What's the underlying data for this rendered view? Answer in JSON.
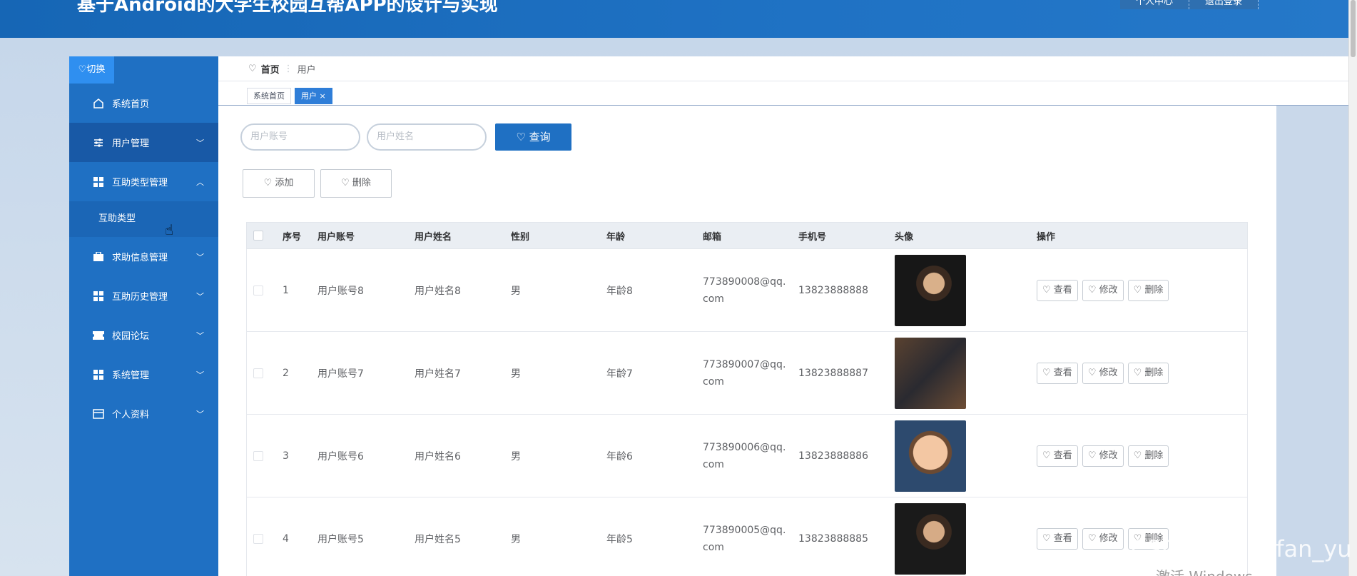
{
  "header": {
    "title": "基于Android的大学生校园互帮APP的设计与实现",
    "buttons": [
      "个人中心",
      "退出登录"
    ]
  },
  "sidebar": {
    "switch_label": "♡切换",
    "items": [
      {
        "label": "系统首页",
        "icon": "home-icon",
        "expand": false
      },
      {
        "label": "用户管理",
        "icon": "sliders-icon",
        "expand": true
      },
      {
        "label": "互助类型管理",
        "icon": "grid-icon",
        "expand": true,
        "open": true
      },
      {
        "label": "互助类型",
        "sub": true
      },
      {
        "label": "求助信息管理",
        "icon": "briefcase-icon",
        "expand": true
      },
      {
        "label": "互助历史管理",
        "icon": "grid-icon",
        "expand": true
      },
      {
        "label": "校园论坛",
        "icon": "ticket-icon",
        "expand": true
      },
      {
        "label": "系统管理",
        "icon": "grid-icon",
        "expand": true
      },
      {
        "label": "个人资料",
        "icon": "card-icon",
        "expand": true
      }
    ]
  },
  "breadcrumb": {
    "home": "首页",
    "sep": "⋮",
    "current": "用户"
  },
  "tabs": [
    {
      "label": "系统首页",
      "active": false
    },
    {
      "label": "用户 ×",
      "active": true
    }
  ],
  "search": {
    "account_placeholder": "用户账号",
    "name_placeholder": "用户姓名",
    "button": "查询"
  },
  "actions": {
    "add": "添加",
    "delete": "删除"
  },
  "table": {
    "headers": [
      "序号",
      "用户账号",
      "用户姓名",
      "性别",
      "年龄",
      "邮箱",
      "手机号",
      "头像",
      "操作"
    ],
    "rows": [
      {
        "index": "1",
        "account": "用户账号8",
        "name": "用户姓名8",
        "gender": "男",
        "age": "年龄8",
        "email_1": "773890008@qq.",
        "email_2": "com",
        "phone": "13823888888",
        "avatar": "av1"
      },
      {
        "index": "2",
        "account": "用户账号7",
        "name": "用户姓名7",
        "gender": "男",
        "age": "年龄7",
        "email_1": "773890007@qq.",
        "email_2": "com",
        "phone": "13823888887",
        "avatar": "av2"
      },
      {
        "index": "3",
        "account": "用户账号6",
        "name": "用户姓名6",
        "gender": "男",
        "age": "年龄6",
        "email_1": "773890006@qq.",
        "email_2": "com",
        "phone": "13823888886",
        "avatar": "av3"
      },
      {
        "index": "4",
        "account": "用户账号5",
        "name": "用户姓名5",
        "gender": "男",
        "age": "年龄5",
        "email_1": "773890005@qq.",
        "email_2": "com",
        "phone": "13823888885",
        "avatar": "av4"
      }
    ],
    "row_ops": [
      "查看",
      "修改",
      "删除"
    ]
  },
  "watermark": {
    "csdn": "CSDN @pingfan_yu",
    "windows": "激活 Windows"
  }
}
